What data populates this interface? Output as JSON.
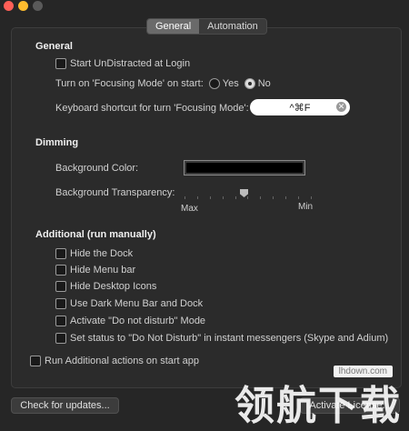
{
  "window": {
    "controls": [
      "close",
      "minimize",
      "zoom"
    ]
  },
  "tabs": [
    {
      "label": "General",
      "active": true
    },
    {
      "label": "Automation",
      "active": false
    }
  ],
  "general": {
    "title": "General",
    "start_login": {
      "label": "Start UnDistracted at Login",
      "checked": false
    },
    "focus_on_start": {
      "label": "Turn on 'Focusing Mode' on start:",
      "yes": "Yes",
      "no": "No",
      "selected": "No"
    },
    "shortcut": {
      "label": "Keyboard shortcut for turn 'Focusing Mode':",
      "value": "^⌘F"
    }
  },
  "dimming": {
    "title": "Dimming",
    "bg_color": {
      "label": "Background Color:",
      "color": "#000000"
    },
    "bg_transparency": {
      "label": "Background Transparency:",
      "min_label": "Max",
      "max_label": "Min"
    }
  },
  "additional": {
    "title": "Additional (run manually)",
    "items": [
      "Hide the Dock",
      "Hide Menu bar",
      "Hide Desktop Icons",
      "Use Dark Menu Bar and Dock",
      "Activate \"Do not disturb\" Mode",
      "Set status to \"Do Not Disturb\" in instant messengers (Skype and Adium)"
    ],
    "run_on_start": "Run Additional actions on start app"
  },
  "footer": {
    "check_updates": "Check for updates...",
    "license": "Activate License..."
  },
  "watermark": {
    "badge": "lhdown.com",
    "text": "领航下载"
  }
}
